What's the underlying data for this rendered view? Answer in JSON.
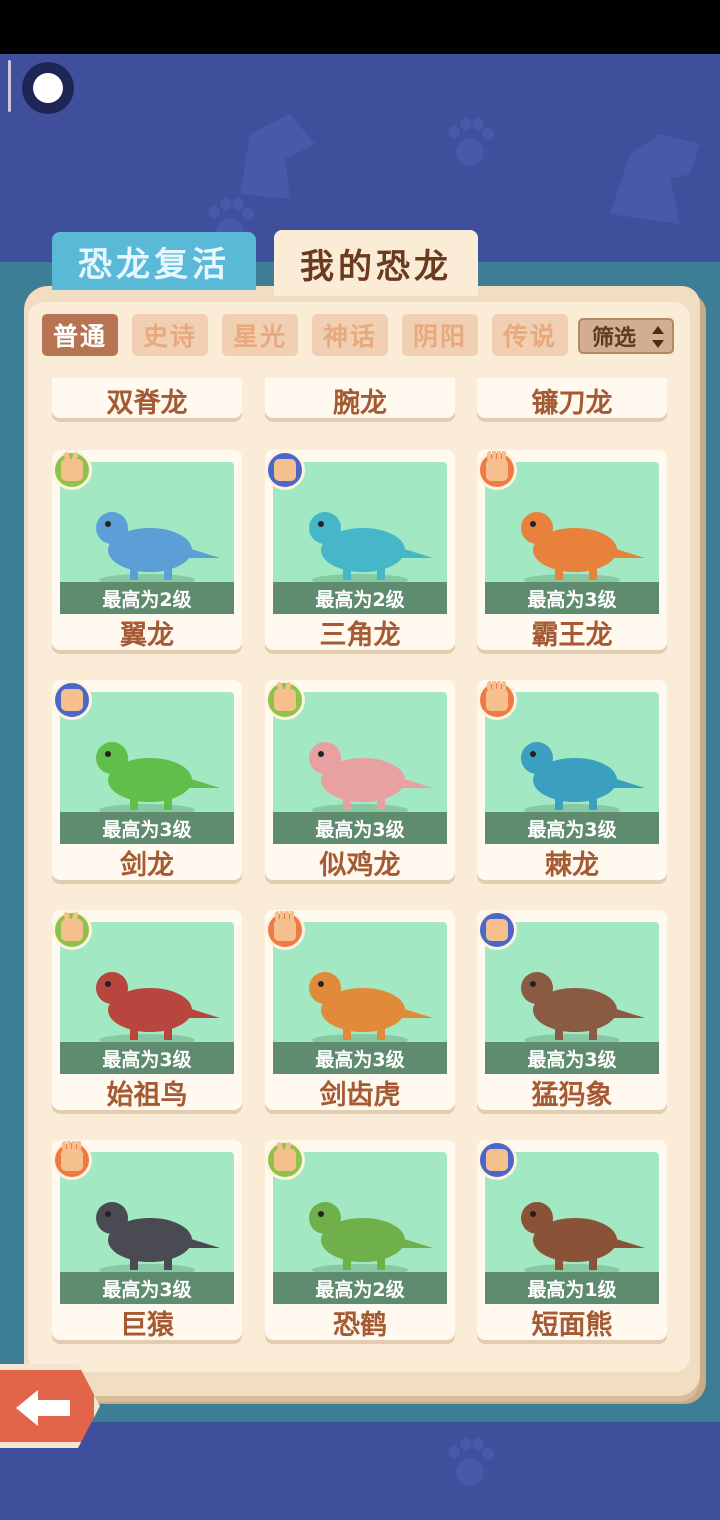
{
  "tabs": [
    {
      "label": "恐龙复活",
      "active": false
    },
    {
      "label": "我的恐龙",
      "active": true
    }
  ],
  "filters": [
    {
      "label": "普通",
      "active": true
    },
    {
      "label": "史诗",
      "active": false
    },
    {
      "label": "星光",
      "active": false
    },
    {
      "label": "神话",
      "active": false
    },
    {
      "label": "阴阳",
      "active": false
    },
    {
      "label": "传说",
      "active": false
    }
  ],
  "filter_select": {
    "label": "筛选"
  },
  "top_partial_row": [
    "双脊龙",
    "腕龙",
    "镰刀龙"
  ],
  "cards": [
    {
      "name": "翼龙",
      "level": "最高为2级",
      "badge": "scissors",
      "badge_color": "green",
      "icon": "pterosaur-icon",
      "color": "#5b9fd6"
    },
    {
      "name": "三角龙",
      "level": "最高为2级",
      "badge": "rock",
      "badge_color": "blue",
      "icon": "triceratops-icon",
      "color": "#46b6c9"
    },
    {
      "name": "霸王龙",
      "level": "最高为3级",
      "badge": "paper",
      "badge_color": "orange",
      "icon": "trex-icon",
      "color": "#e8813c"
    },
    {
      "name": "剑龙",
      "level": "最高为3级",
      "badge": "rock",
      "badge_color": "blue",
      "icon": "stegosaurus-icon",
      "color": "#5fbf4a"
    },
    {
      "name": "似鸡龙",
      "level": "最高为3级",
      "badge": "scissors",
      "badge_color": "green",
      "icon": "gallimimus-icon",
      "color": "#e9a0a0"
    },
    {
      "name": "棘龙",
      "level": "最高为3级",
      "badge": "paper",
      "badge_color": "orange",
      "icon": "spinosaurus-icon",
      "color": "#3b9fc0"
    },
    {
      "name": "始祖鸟",
      "level": "最高为3级",
      "badge": "scissors",
      "badge_color": "green",
      "icon": "archaeopteryx-icon",
      "color": "#b8463f"
    },
    {
      "name": "剑齿虎",
      "level": "最高为3级",
      "badge": "paper",
      "badge_color": "orange",
      "icon": "sabertooth-icon",
      "color": "#e08a3a"
    },
    {
      "name": "猛犸象",
      "level": "最高为3级",
      "badge": "rock",
      "badge_color": "blue",
      "icon": "mammoth-icon",
      "color": "#8a5a42"
    },
    {
      "name": "巨猿",
      "level": "最高为3级",
      "badge": "paper",
      "badge_color": "orange",
      "icon": "gorilla-icon",
      "color": "#4a4a52"
    },
    {
      "name": "恐鹤",
      "level": "最高为2级",
      "badge": "scissors",
      "badge_color": "green",
      "icon": "terror-bird-icon",
      "color": "#6fb04a"
    },
    {
      "name": "短面熊",
      "level": "最高为1级",
      "badge": "rock",
      "badge_color": "blue",
      "icon": "short-faced-bear-icon",
      "color": "#8a5236"
    }
  ],
  "back_button": {
    "icon": "back-arrow-icon"
  }
}
